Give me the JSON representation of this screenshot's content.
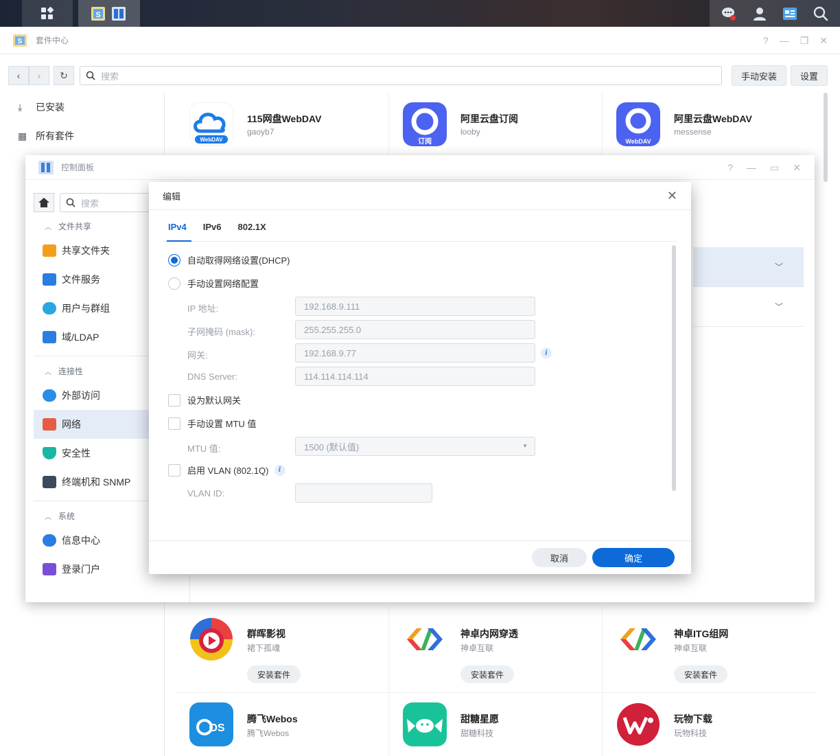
{
  "package_center": {
    "title": "套件中心",
    "search_placeholder": "搜索",
    "manual_install": "手动安装",
    "settings": "设置",
    "sidebar": [
      {
        "label": "已安装",
        "icon": "download-icon"
      },
      {
        "label": "所有套件",
        "icon": "grid-icon"
      }
    ],
    "packages": [
      {
        "name": "115网盘WebDAV",
        "author": "gaoyb7",
        "icon_color": "#1c7be8"
      },
      {
        "name": "阿里云盘订阅",
        "author": "looby",
        "icon_color": "#4c62f0"
      },
      {
        "name": "阿里云盘WebDAV",
        "author": "messense",
        "icon_color": "#4c62f0"
      },
      {
        "name": "群晖影视",
        "author": "裙下孤魂",
        "install": "安装套件",
        "icon_color": "#e84141"
      },
      {
        "name": "神卓内网穿透",
        "author": "神卓互联",
        "install": "安装套件",
        "icon_color": "#f0a020"
      },
      {
        "name": "神卓ITG组网",
        "author": "神卓互联",
        "install": "安装套件",
        "icon_color": "#f0a020"
      },
      {
        "name": "腾飞Webos",
        "author": "腾飞Webos",
        "icon_color": "#1d8ee0"
      },
      {
        "name": "甜糖星愿",
        "author": "甜糖科技",
        "icon_color": "#19c39a"
      },
      {
        "name": "玩物下载",
        "author": "玩物科技",
        "icon_color": "#d0203a"
      }
    ]
  },
  "control_panel": {
    "title": "控制面板",
    "search_placeholder": "搜索",
    "sections": [
      {
        "title": "文件共享",
        "items": [
          {
            "label": "共享文件夹",
            "icon": "folder-icon",
            "color": "#f59e1b"
          },
          {
            "label": "文件服务",
            "icon": "file-service-icon",
            "color": "#2a7de1"
          },
          {
            "label": "用户与群组",
            "icon": "users-icon",
            "color": "#2aa7e0"
          },
          {
            "label": "域/LDAP",
            "icon": "ldap-icon",
            "color": "#2a7de1"
          }
        ]
      },
      {
        "title": "连接性",
        "items": [
          {
            "label": "外部访问",
            "icon": "globe-icon",
            "color": "#2a8de8"
          },
          {
            "label": "网络",
            "icon": "house-icon",
            "color": "#e55b45"
          },
          {
            "label": "安全性",
            "icon": "shield-icon",
            "color": "#1bb6a3"
          },
          {
            "label": "终端机和 SNMP",
            "icon": "terminal-icon",
            "color": "#3c4a5e"
          }
        ]
      },
      {
        "title": "系统",
        "items": [
          {
            "label": "信息中心",
            "icon": "info-icon",
            "color": "#2a7de1"
          },
          {
            "label": "登录门户",
            "icon": "portal-icon",
            "color": "#7a4fd8"
          }
        ]
      }
    ]
  },
  "dialog": {
    "title": "编辑",
    "tabs": [
      "IPv4",
      "IPv6",
      "802.1X"
    ],
    "dhcp_label": "自动取得网络设置(DHCP)",
    "manual_label": "手动设置网络配置",
    "fields": [
      {
        "label": "IP 地址:",
        "value": "192.168.9.111"
      },
      {
        "label": "子网掩码 (mask):",
        "value": "255.255.255.0"
      },
      {
        "label": "网关:",
        "value": "192.168.9.77"
      },
      {
        "label": "DNS Server:",
        "value": "114.114.114.114"
      }
    ],
    "default_gateway_label": "设为默认网关",
    "mtu_manual_label": "手动设置 MTU 值",
    "mtu_label": "MTU 值:",
    "mtu_value": "1500 (默认值)",
    "vlan_label": "启用 VLAN (802.1Q)",
    "vlan_id_label": "VLAN ID:",
    "vlan_id_value": "",
    "cancel": "取消",
    "ok": "确定"
  }
}
